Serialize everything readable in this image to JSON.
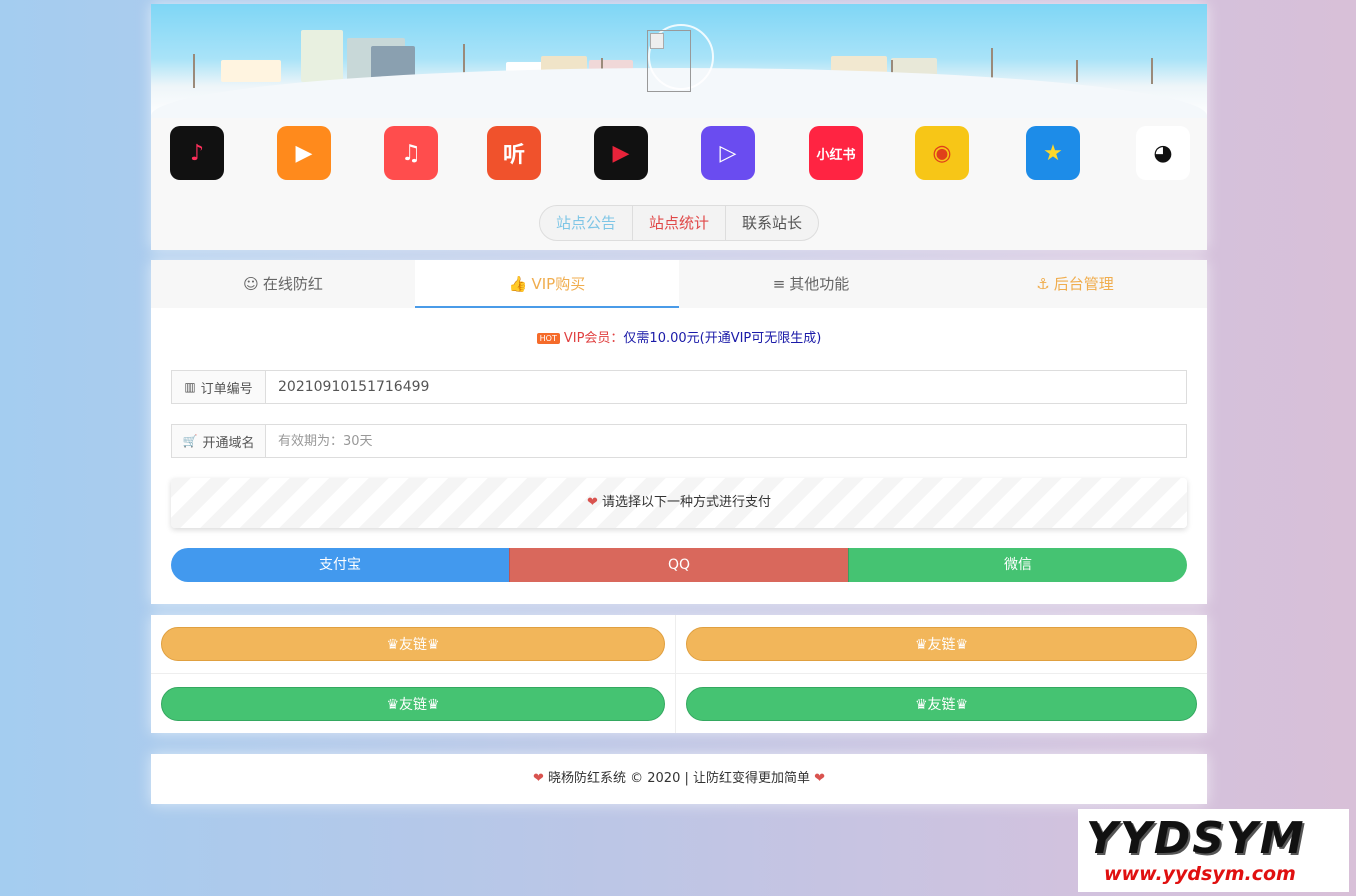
{
  "header": {
    "apps": [
      {
        "name": "douyin",
        "glyph": "♪",
        "bg": "#111111",
        "color": "#ff2f5b"
      },
      {
        "name": "kuaishou",
        "glyph": "▶",
        "bg": "#ff8a1c",
        "color": "#ffffff"
      },
      {
        "name": "quanmin-k",
        "glyph": "♫",
        "bg": "#ff4d4d",
        "color": "#ffffff"
      },
      {
        "name": "ting",
        "glyph": "听",
        "bg": "#f0522c",
        "color": "#ffffff"
      },
      {
        "name": "video-red",
        "glyph": "▶",
        "bg": "#111111",
        "color": "#e8233a"
      },
      {
        "name": "video-purple",
        "glyph": "▷",
        "bg": "#6a4cf0",
        "color": "#ffffff"
      },
      {
        "name": "xiaohongshu",
        "glyph": "小红书",
        "bg": "#ff2442",
        "color": "#ffffff"
      },
      {
        "name": "cartoon",
        "glyph": "◉",
        "bg": "#f7c617",
        "color": "#e0401a"
      },
      {
        "name": "qq-space",
        "glyph": "★",
        "bg": "#1d8ce8",
        "color": "#ffd82a"
      },
      {
        "name": "qq",
        "glyph": "◕",
        "bg": "#ffffff",
        "color": "#111111"
      }
    ],
    "nav": [
      {
        "label": "站点公告",
        "color": "#7fc6e6"
      },
      {
        "label": "站点统计",
        "color": "#e04848"
      },
      {
        "label": "联系站长",
        "color": "#555555"
      }
    ]
  },
  "tabs": [
    {
      "icon": "☺",
      "label": "在线防红",
      "active": false,
      "color": "#666666"
    },
    {
      "icon": "👍",
      "label": "VIP购买",
      "active": true,
      "color": "#f0ad4e"
    },
    {
      "icon": "≡",
      "label": "其他功能",
      "active": false,
      "color": "#666666"
    },
    {
      "icon": "⚓",
      "label": "后台管理",
      "active": false,
      "color": "#f0ad4e"
    }
  ],
  "vip": {
    "hot_badge": "HOT",
    "notice_prefix": "VIP会员：",
    "notice_text": "仅需10.00元(开通VIP可无限生成)",
    "order_label": "订单编号",
    "order_value": "20210910151716499",
    "domain_label": "开通域名",
    "domain_placeholder": "有效期为：30天",
    "pay_prompt": "请选择以下一种方式进行支付",
    "pay_alipay": "支付宝",
    "pay_qq": "QQ",
    "pay_wechat": "微信"
  },
  "links": [
    "♛友链♛",
    "♛友链♛",
    "♛友链♛",
    "♛友链♛"
  ],
  "footer": {
    "text": "晓杨防红系统 © 2020 | 让防红变得更加简单"
  },
  "watermark": {
    "big": "YYDSYM",
    "small": "www.yydsym.com"
  },
  "colors": {
    "alipay": "#4299ee",
    "qq": "#d9685c",
    "wechat": "#45c372",
    "orange": "#f2b65a"
  }
}
